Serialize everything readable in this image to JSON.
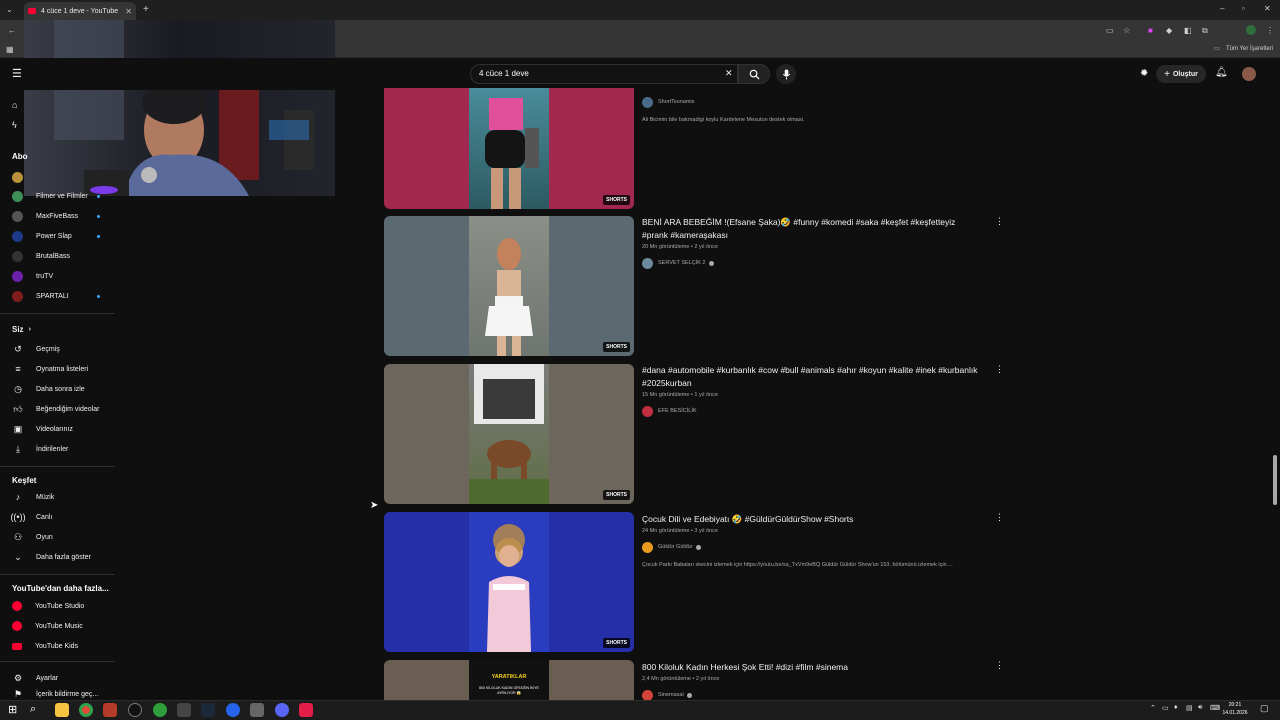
{
  "browser": {
    "tab_title": "4 cüce 1 deve - YouTube",
    "new_tab": "+",
    "bookmarks_label": "Tüm Yer İşaretleri"
  },
  "header": {
    "search_value": "4 cüce 1 deve",
    "create_label": "Oluştur"
  },
  "sidebar": {
    "subscriptions_head": "Abo",
    "subscriptions": [
      {
        "label": "Filmer ve Filmler",
        "color": "#3e8e5a",
        "dot": true
      },
      {
        "label": "MaxFiveBass",
        "color": "#555555",
        "dot": true
      },
      {
        "label": "Power Slap",
        "color": "#1e3a8a",
        "dot": true
      },
      {
        "label": "BrutalBass",
        "color": "#333333",
        "dot": false
      },
      {
        "label": "truTV",
        "color": "#6b21a8",
        "dot": false
      },
      {
        "label": "SPARTALI",
        "color": "#7f1d1d",
        "dot": true
      }
    ],
    "you_head": "Siz",
    "you_items": [
      {
        "label": "Geçmiş",
        "icon": "history-icon"
      },
      {
        "label": "Oynatma listeleri",
        "icon": "playlist-icon"
      },
      {
        "label": "Daha sonra izle",
        "icon": "clock-icon"
      },
      {
        "label": "Beğendiğim videolar",
        "icon": "like-icon"
      },
      {
        "label": "Videolarınız",
        "icon": "video-icon"
      },
      {
        "label": "İndirilenler",
        "icon": "download-icon"
      }
    ],
    "explore_head": "Keşfet",
    "explore_items": [
      {
        "label": "Müzik",
        "icon": "music-icon"
      },
      {
        "label": "Canlı",
        "icon": "live-icon"
      },
      {
        "label": "Oyun",
        "icon": "game-icon"
      },
      {
        "label": "Daha fazla göster",
        "icon": "chevron-down-icon"
      }
    ],
    "more_head": "YouTube'dan daha fazla...",
    "more_items": [
      {
        "label": "YouTube Studio"
      },
      {
        "label": "YouTube Music"
      },
      {
        "label": "YouTube Kids"
      }
    ],
    "settings_label": "Ayarlar",
    "report_label": "İçerik bildirme geç..."
  },
  "results": [
    {
      "title": "",
      "meta": "",
      "channel": "ShortTsunamis",
      "verified": false,
      "desc": "Ali Bicimin bile bakmadigi koylu Kardelene Mesutun destek olmasi.",
      "badge": "SHORTS",
      "side_color": "#a3284f",
      "center_color": "#3b6a6f"
    },
    {
      "title": "BENİ ARA BEBEĞİM !(Efsane Şaka)🤣 #funny #komedi #saka #keşfet #keşfetteyiz #prank #kameraşakası",
      "meta": "20 Mn görüntüleme • 2 yıl önce",
      "channel": "SERVET SELÇİK 2",
      "verified": true,
      "desc": "",
      "badge": "SHORTS",
      "side_color": "#5b6a70",
      "center_color": "#8a8f88"
    },
    {
      "title": "#dana #automobile #kurbanlık #cow #bull #animals #ahır #koyun #kalite #inek #kurbanlık #2025kurban",
      "meta": "15 Mn görüntüleme • 1 yıl önce",
      "channel": "EFE BESİCİLİK",
      "verified": false,
      "desc": "",
      "badge": "SHORTS",
      "side_color": "#6c665c",
      "center_color": "#6b5a40"
    },
    {
      "title": "Çocuk Dili ve Edebiyatı 🤣 #GüldürGüldürShow #Shorts",
      "meta": "24 Mn görüntüleme • 3 yıl önce",
      "channel": "Güldür Güldür",
      "verified": true,
      "desc": "Çocuk Parkı Babaları skecini izlemek için https://youtu.be/sa_TxVm9eBQ Güldür Güldür Show'un 153. bölümünü izlemek için ...",
      "badge": "SHORTS",
      "side_color": "#2530a8",
      "center_color": "#2a3cc0"
    },
    {
      "title": "800 Kiloluk Kadın Herkesi Şok Etti! #dizi #film #sinema",
      "meta": "2,4 Mn görüntüleme • 2 yıl önce",
      "channel": "Sinemasal",
      "verified": true,
      "desc": "",
      "badge": "",
      "side_color": "#6a5e52",
      "center_color": "#111111",
      "center_text": "YARATIKLAR",
      "center_sub": "800 KİLOLUK KADIN ORTAĞIN İKİYE AYRILIYOR 😱"
    }
  ],
  "taskbar": {
    "time": "20:21",
    "date": "14.01.2026"
  },
  "colors": {
    "accent": "#ff0033",
    "bg": "#0f0f0f",
    "verified": "#aaaaaa"
  }
}
